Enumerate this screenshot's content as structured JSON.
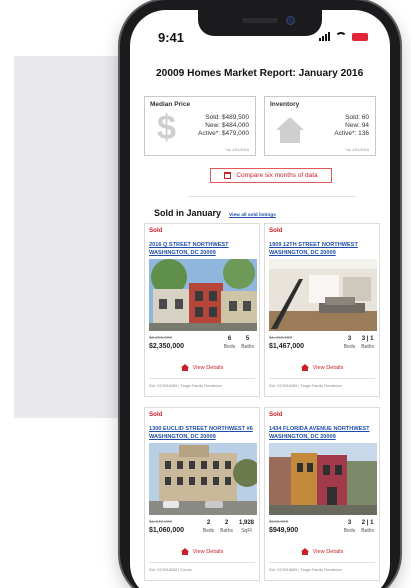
{
  "status_bar": {
    "time": "9:41"
  },
  "report": {
    "title": "20009 Homes Market Report: January 2016"
  },
  "median_price": {
    "label": "Median Price",
    "sold": "Sold: $489,500",
    "new": "New: $484,000",
    "active": "Active*: $479,000",
    "note": "*on 1/31/2016"
  },
  "inventory": {
    "label": "Inventory",
    "sold": "Sold: 60",
    "new": "New: 94",
    "active": "Active*: 136",
    "note": "*on 1/31/2016"
  },
  "compare_button": {
    "label": "Compare six months of data"
  },
  "sold_section": {
    "title": "Sold in January",
    "view_all": "View all sold listings"
  },
  "listings": [
    {
      "status": "Sold",
      "street": "2016 Q STREET NORTHWEST",
      "city": "WASHINGTON, DC 20009",
      "prev_price": "$2,350,000",
      "price": "$2,350,000",
      "facts": [
        {
          "value": "6",
          "label": "Beds"
        },
        {
          "value": "5",
          "label": "Baths"
        }
      ],
      "details": "View Details",
      "id_line": "ID#: DC9518455 | Single Family Residence"
    },
    {
      "status": "Sold",
      "street": "1909 12TH STREET NORTHWEST",
      "city": "WASHINGTON, DC 20009",
      "prev_price": "$1,499,000",
      "price": "$1,467,000",
      "facts": [
        {
          "value": "3",
          "label": "Beds"
        },
        {
          "value": "3 | 1",
          "label": "Baths"
        }
      ],
      "details": "View Details",
      "id_line": "ID#: DC9518455 | Single Family Residence"
    },
    {
      "status": "Sold",
      "street": "1300 EUCLID STREET NORTHWEST #6",
      "city": "WASHINGTON, DC 20009",
      "prev_price": "$1,049,000",
      "price": "$1,060,000",
      "facts": [
        {
          "value": "2",
          "label": "Beds"
        },
        {
          "value": "2",
          "label": "Baths"
        },
        {
          "value": "1,928",
          "label": "SqFt"
        }
      ],
      "details": "View Details",
      "id_line": "ID#: DC9518348 | Condo"
    },
    {
      "status": "Sold",
      "street": "1434 FLORIDA AVENUE NORTHWEST",
      "city": "WASHINGTON, DC 20009",
      "prev_price": "$949,900",
      "price": "$949,900",
      "facts": [
        {
          "value": "3",
          "label": "Beds"
        },
        {
          "value": "2 | 1",
          "label": "Baths"
        }
      ],
      "details": "View Details",
      "id_line": "ID#: DC9518885 | Single Family Residence"
    }
  ]
}
